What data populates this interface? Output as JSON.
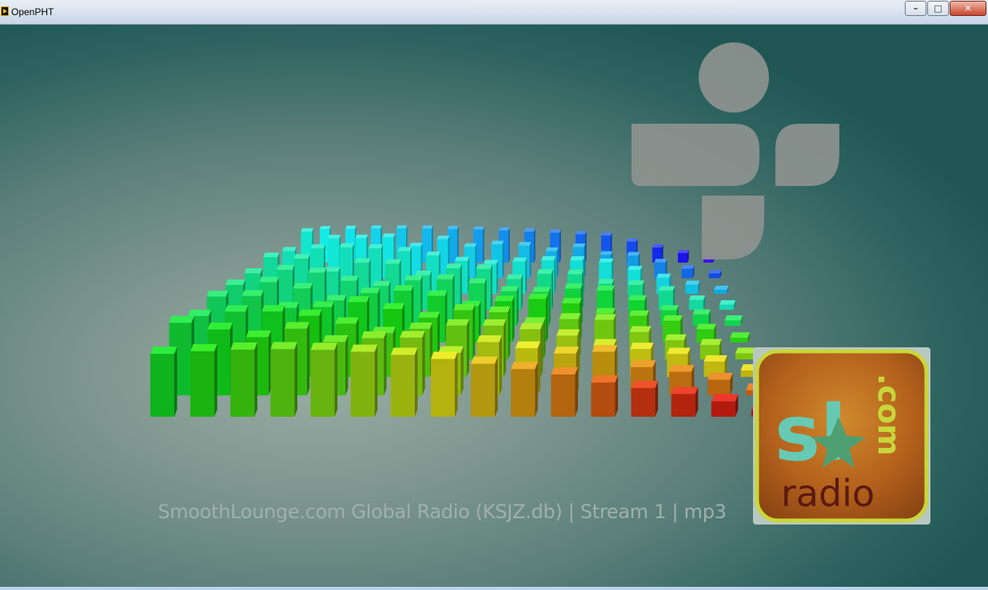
{
  "window": {
    "title": "OpenPHT",
    "buttons": {
      "minimize": "–",
      "maximize": "□",
      "close": "✕"
    }
  },
  "player": {
    "stream_info": "SmoothLounge.com Global Radio (KSJZ.db) | Stream 1 | mp3",
    "station_logo": {
      "line1": "sl",
      "line2": "radio",
      "suffix": ".com"
    }
  },
  "colors": {
    "background": "#5a7e79",
    "tunein_logo": "#8f9490",
    "station_logo_bg": "#b86a1e",
    "station_logo_border": "#c8d63a"
  },
  "visualizer": {
    "type": "3d-spectrum",
    "columns": 16,
    "rows": 10,
    "gradient": [
      "green",
      "yellow",
      "orange",
      "red",
      "purple",
      "blue",
      "cyan"
    ]
  }
}
